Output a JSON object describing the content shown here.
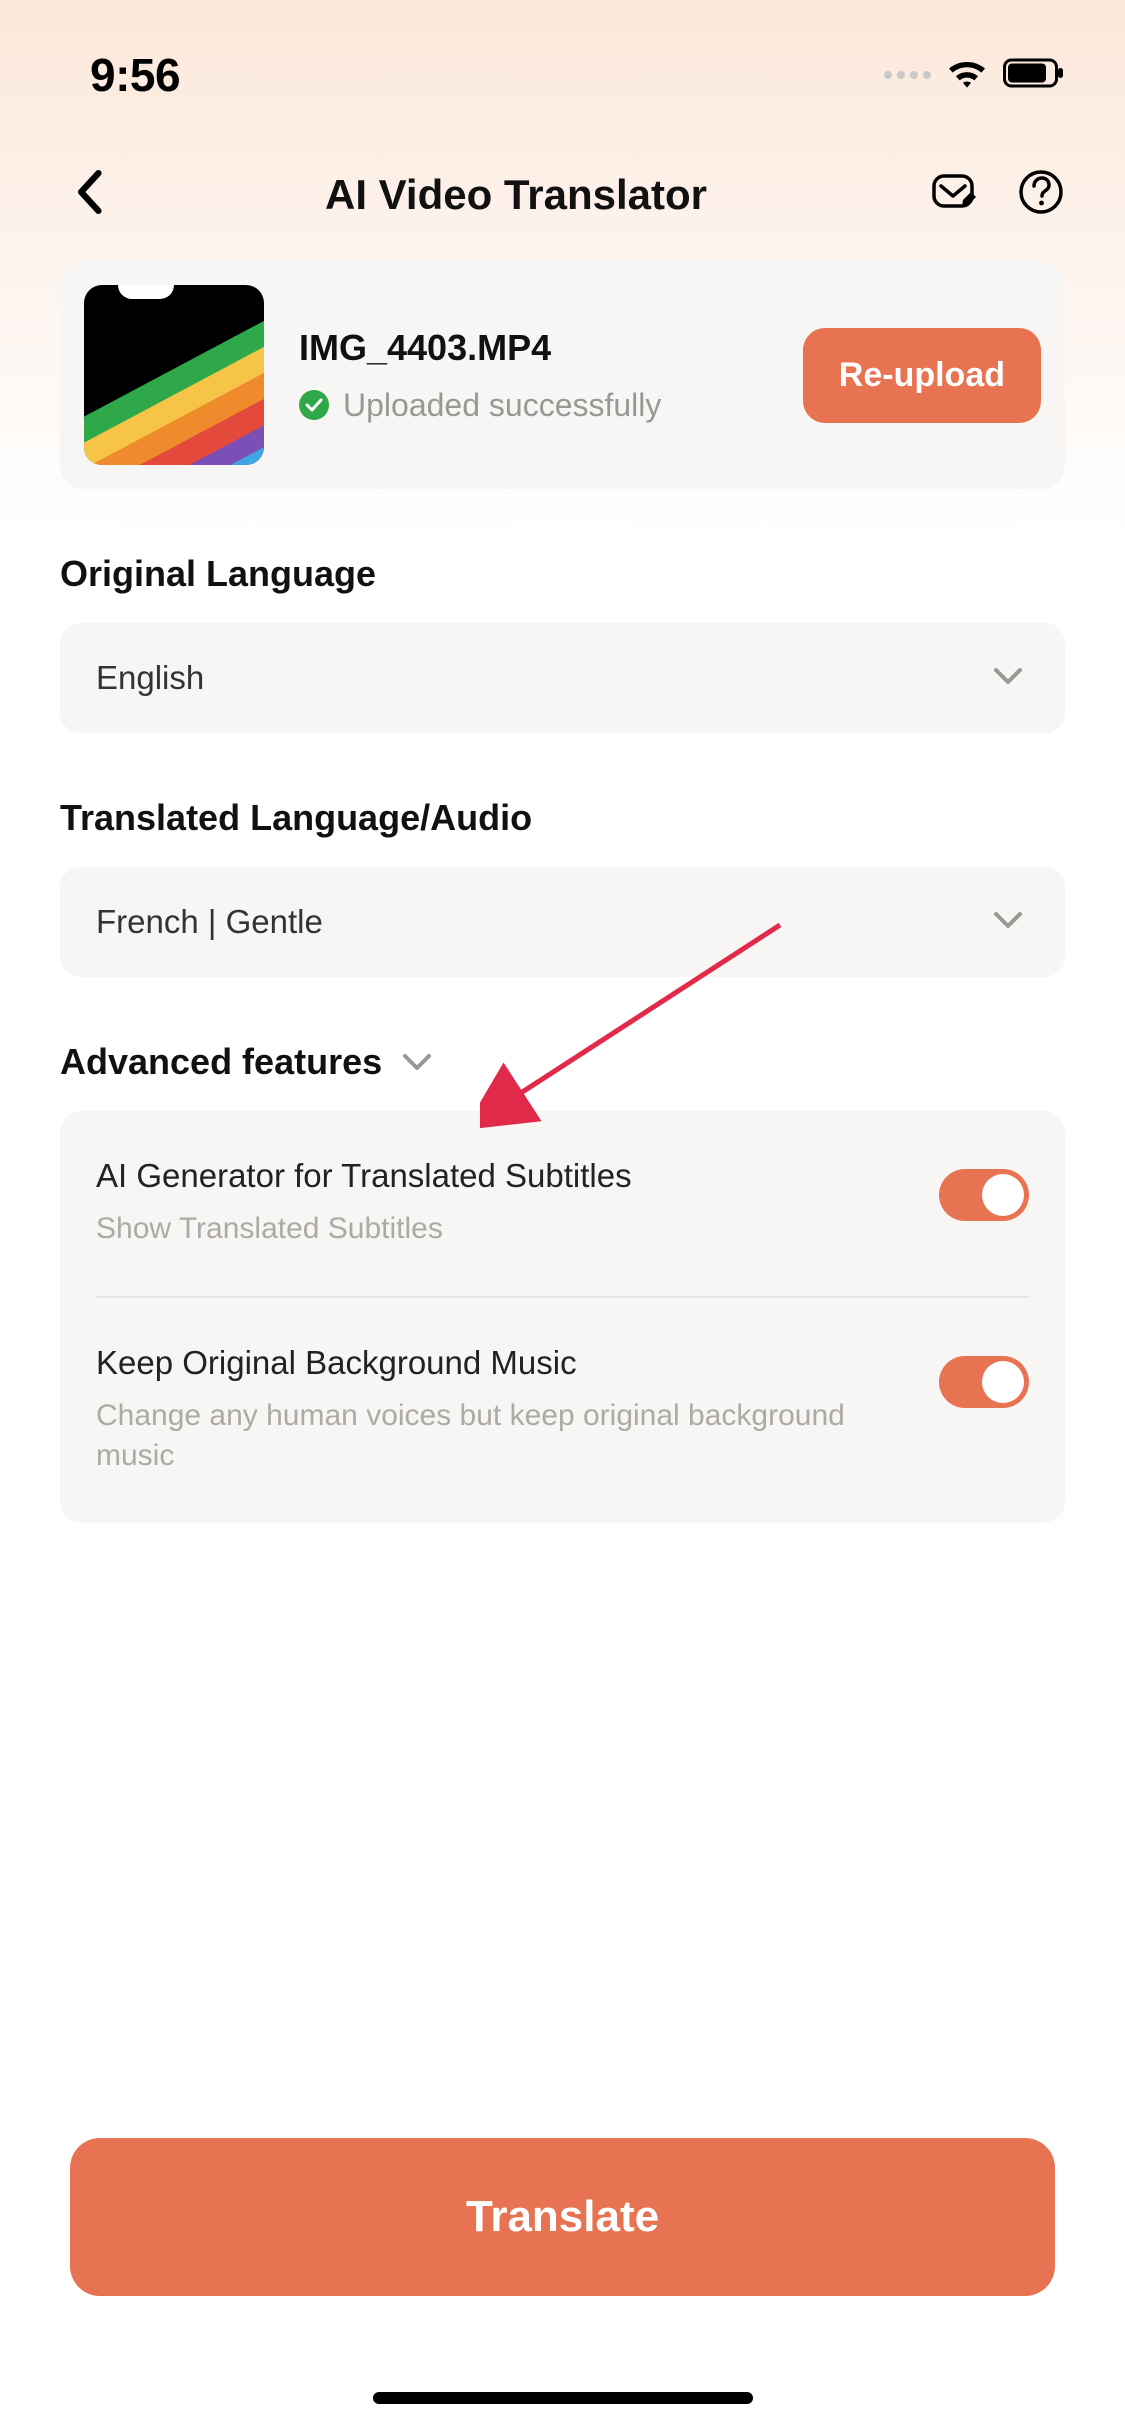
{
  "status": {
    "time": "9:56"
  },
  "header": {
    "title": "AI Video Translator"
  },
  "upload": {
    "filename": "IMG_4403.MP4",
    "status_text": "Uploaded successfully",
    "reupload_label": "Re-upload"
  },
  "sections": {
    "original_label": "Original Language",
    "original_value": "English",
    "translated_label": "Translated Language/Audio",
    "translated_value": "French  |  Gentle",
    "advanced_label": "Advanced features"
  },
  "features": {
    "subtitles": {
      "title": "AI Generator for Translated Subtitles",
      "desc": "Show Translated Subtitles",
      "on": true
    },
    "bgmusic": {
      "title": "Keep Original Background Music",
      "desc": "Change any human voices but keep original background music",
      "on": true
    }
  },
  "cta": {
    "translate": "Translate"
  },
  "colors": {
    "accent": "#e87352"
  }
}
